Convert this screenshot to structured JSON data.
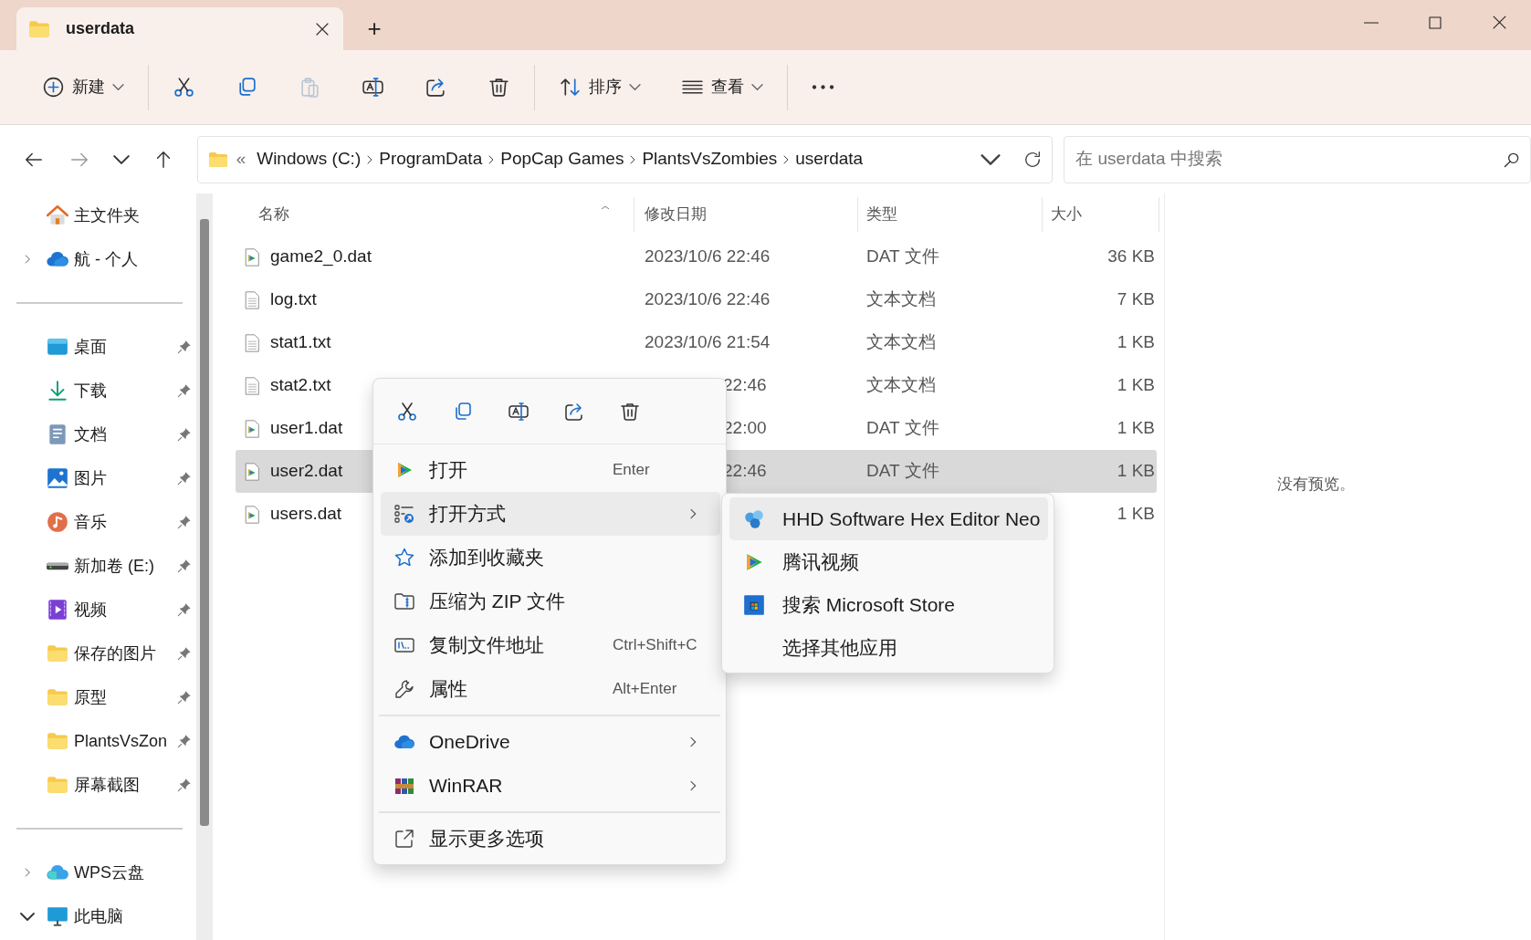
{
  "window": {
    "tab_title": "userdata",
    "new_tab": "+"
  },
  "toolbar": [
    {
      "kind": "new",
      "label": "新建",
      "disabled": false
    },
    {
      "kind": "separator"
    },
    {
      "kind": "cut",
      "disabled": false
    },
    {
      "kind": "copy",
      "disabled": false
    },
    {
      "kind": "paste",
      "disabled": true
    },
    {
      "kind": "rename",
      "disabled": false
    },
    {
      "kind": "share",
      "disabled": false
    },
    {
      "kind": "delete",
      "disabled": false
    },
    {
      "kind": "separator"
    },
    {
      "kind": "sort",
      "label": "排序",
      "disabled": false
    },
    {
      "kind": "view",
      "label": "查看",
      "disabled": false
    },
    {
      "kind": "separator"
    },
    {
      "kind": "more",
      "disabled": false
    }
  ],
  "navigation": {
    "forward_disabled": true
  },
  "address": {
    "overflow": "«",
    "crumbs": [
      "Windows (C:)",
      "ProgramData",
      "PopCap Games",
      "PlantsVsZombies",
      "userdata"
    ]
  },
  "search": {
    "placeholder": "在 userdata 中搜索"
  },
  "sidebar": [
    {
      "kind": "home",
      "label": "主文件夹"
    },
    {
      "kind": "onedrive",
      "label": "航 - 个人",
      "expanded": false
    },
    {
      "kind": "divider"
    },
    {
      "kind": "desktop",
      "label": "桌面",
      "pinned": true
    },
    {
      "kind": "downloads",
      "label": "下载",
      "pinned": true
    },
    {
      "kind": "documents",
      "label": "文档",
      "pinned": true
    },
    {
      "kind": "pictures",
      "label": "图片",
      "pinned": true
    },
    {
      "kind": "music",
      "label": "音乐",
      "pinned": true
    },
    {
      "kind": "drive",
      "label": "新加卷 (E:)",
      "pinned": true
    },
    {
      "kind": "videos",
      "label": "视频",
      "pinned": true
    },
    {
      "kind": "folder",
      "label": "保存的图片",
      "pinned": true
    },
    {
      "kind": "folder",
      "label": "原型",
      "pinned": true
    },
    {
      "kind": "folder",
      "label": "PlantsVsZon",
      "pinned": true
    },
    {
      "kind": "folder",
      "label": "屏幕截图",
      "pinned": true
    },
    {
      "kind": "divider"
    },
    {
      "kind": "wps",
      "label": "WPS云盘",
      "expanded": false
    },
    {
      "kind": "pc",
      "label": "此电脑",
      "expanded": true
    }
  ],
  "table": {
    "columns": [
      "名称",
      "修改日期",
      "类型",
      "大小"
    ],
    "rows": [
      {
        "kind": "dat",
        "name": "game2_0.dat",
        "date": "2023/10/6 22:46",
        "type": "DAT 文件",
        "size": "36 KB",
        "selected": false,
        "obscured": false
      },
      {
        "kind": "txt",
        "name": "log.txt",
        "date": "2023/10/6 22:46",
        "type": "文本文档",
        "size": "7 KB",
        "selected": false,
        "obscured": false
      },
      {
        "kind": "txt",
        "name": "stat1.txt",
        "date": "2023/10/6 21:54",
        "type": "文本文档",
        "size": "1 KB",
        "selected": false,
        "obscured": false
      },
      {
        "kind": "txt",
        "name": "stat2.txt",
        "date": "22:46",
        "type": "文本文档",
        "size": "1 KB",
        "selected": false,
        "obscured": true
      },
      {
        "kind": "dat",
        "name": "user1.dat",
        "date": "22:00",
        "type": "DAT 文件",
        "size": "1 KB",
        "selected": false,
        "obscured": true
      },
      {
        "kind": "dat",
        "name": "user2.dat",
        "date": "22:46",
        "type": "DAT 文件",
        "size": "1 KB",
        "selected": true,
        "obscured": true
      },
      {
        "kind": "dat",
        "name": "users.dat",
        "size": "1 KB",
        "selected": false
      }
    ]
  },
  "preview": {
    "message": "没有预览。"
  },
  "context_menu": {
    "quick_actions": [
      {
        "kind": "cut"
      },
      {
        "kind": "copy"
      },
      {
        "kind": "rename"
      },
      {
        "kind": "share"
      },
      {
        "kind": "delete"
      }
    ],
    "groups": [
      [
        {
          "kind": "play",
          "label": "打开",
          "shortcut": "Enter",
          "submenu": false,
          "selected": false
        },
        {
          "kind": "openwith",
          "label": "打开方式",
          "submenu": true,
          "selected": true
        },
        {
          "kind": "star",
          "label": "添加到收藏夹",
          "submenu": false,
          "selected": false
        },
        {
          "kind": "zip",
          "label": "压缩为 ZIP 文件",
          "submenu": false,
          "selected": false
        },
        {
          "kind": "path",
          "label": "复制文件地址",
          "shortcut": "Ctrl+Shift+C",
          "submenu": false,
          "selected": false
        },
        {
          "kind": "wrench",
          "label": "属性",
          "shortcut": "Alt+Enter",
          "submenu": false,
          "selected": false
        }
      ],
      [
        {
          "kind": "onedrive",
          "label": "OneDrive",
          "submenu": true,
          "selected": false
        },
        {
          "kind": "winrar",
          "label": "WinRAR",
          "submenu": true,
          "selected": false
        }
      ],
      [
        {
          "kind": "moreoptions",
          "label": "显示更多选项",
          "submenu": false,
          "selected": false
        }
      ]
    ]
  },
  "submenu": [
    {
      "kind": "hex",
      "label": "HHD Software Hex Editor Neo",
      "selected": true
    },
    {
      "kind": "play",
      "label": "腾讯视频",
      "selected": false
    },
    {
      "kind": "store",
      "label": "搜索 Microsoft Store",
      "selected": false
    },
    {
      "kind": "none",
      "label": "选择其他应用",
      "selected": false
    }
  ]
}
